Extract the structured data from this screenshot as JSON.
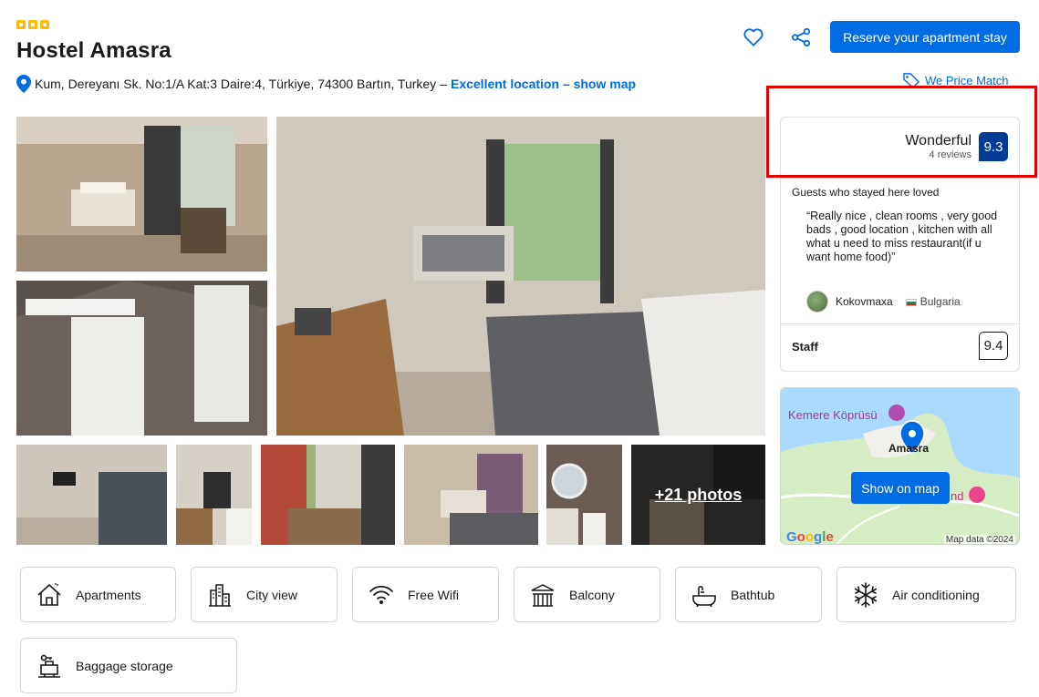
{
  "property": {
    "stars": 3,
    "name": "Hostel Amasra",
    "address": "Kum, Dereyanı Sk. No:1/A Kat:3 Daire:4, Türkiye, 74300 Bartın, Turkey",
    "separator": "–",
    "location_link": "Excellent location – show map"
  },
  "actions": {
    "favorite_icon": "heart-icon",
    "share_icon": "share-icon",
    "reserve_label": "Reserve your apartment stay",
    "price_match_label": "We Price Match"
  },
  "gallery": {
    "more_photos_label": "+21 photos"
  },
  "review": {
    "score_word": "Wonderful",
    "review_count": "4 reviews",
    "score": "9.3",
    "loved_title": "Guests who stayed here loved",
    "quote": "“Really nice , clean rooms , very good bads , good location , kitchen with all what u need to miss restaurant(if u want home food)”",
    "reviewer_name": "Kokovmaxa",
    "reviewer_country": "Bulgaria",
    "staff_label": "Staff",
    "staff_score": "9.4"
  },
  "map": {
    "label_bridge": "Kemere Köprüsü",
    "label_town": "Amasra",
    "label_poi": "nd",
    "button_label": "Show on map",
    "google_label": "Google",
    "map_data": "Map data ©2024"
  },
  "facilities": [
    {
      "label": "Apartments",
      "icon": "house-icon"
    },
    {
      "label": "City view",
      "icon": "city-icon"
    },
    {
      "label": "Free Wifi",
      "icon": "wifi-icon"
    },
    {
      "label": "Balcony",
      "icon": "balcony-icon"
    },
    {
      "label": "Bathtub",
      "icon": "bathtub-icon"
    },
    {
      "label": "Air conditioning",
      "icon": "snowflake-icon"
    },
    {
      "label": "Baggage storage",
      "icon": "luggage-icon"
    }
  ],
  "colors": {
    "brand_blue": "#006ce4",
    "score_blue": "#003b95",
    "star_yellow": "#febb02",
    "highlight_red": "#e50000"
  }
}
